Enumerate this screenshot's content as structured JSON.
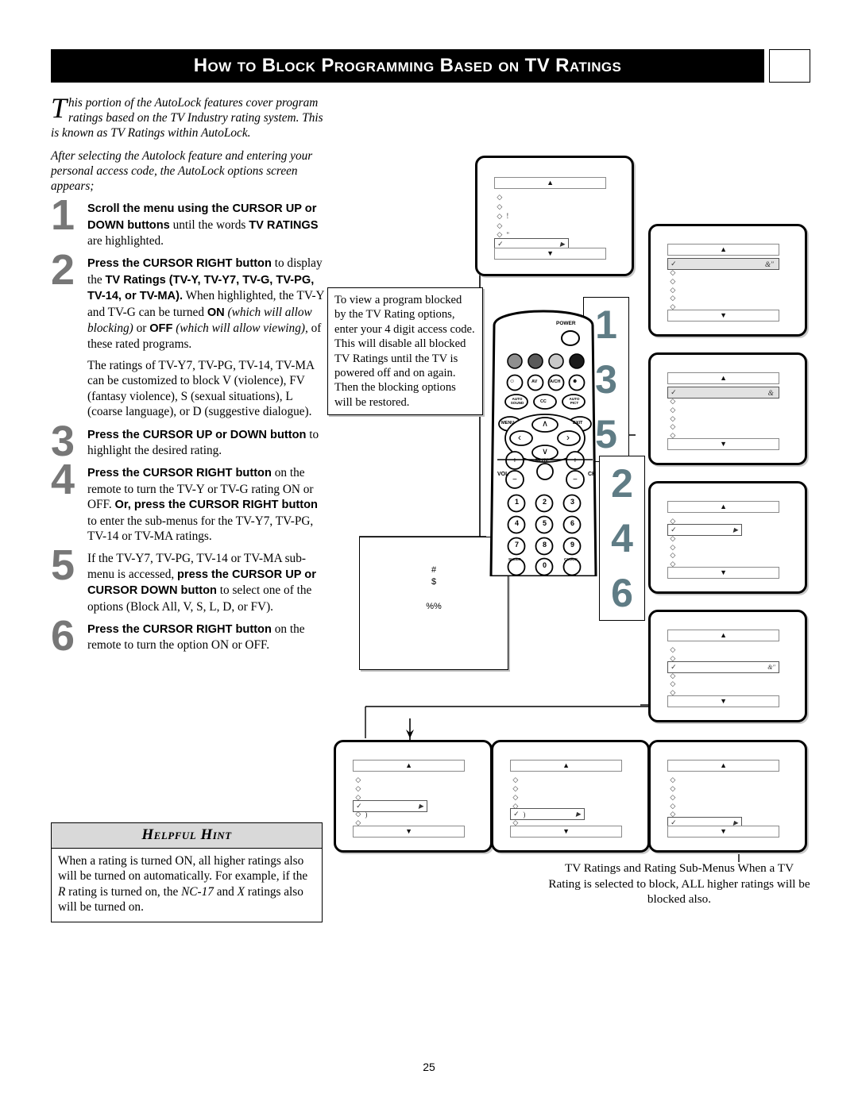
{
  "header": {
    "title": "How to Block Programming Based on TV Ratings",
    "tab": ""
  },
  "intro": {
    "dropcap": "T",
    "paragraph1": "his portion of the AutoLock features cover program ratings based on the TV Industry rating system. This is known as TV Ratings within AutoLock.",
    "paragraph2": "After selecting the Autolock feature and entering your personal access code, the AutoLock options screen appears;"
  },
  "steps": [
    {
      "number": "1",
      "paragraphs": [
        [
          {
            "t": "Scroll the menu using the CURSOR UP or DOWN buttons",
            "s": "b"
          },
          {
            "t": " until the words ",
            "s": "n"
          },
          {
            "t": "TV RATINGS",
            "s": "b"
          },
          {
            "t": " are highlighted.",
            "s": "n"
          }
        ]
      ]
    },
    {
      "number": "2",
      "paragraphs": [
        [
          {
            "t": "Press the CURSOR RIGHT button",
            "s": "b"
          },
          {
            "t": " to display the ",
            "s": "n"
          },
          {
            "t": "TV Ratings (TV-Y, TV-Y7, TV-G, TV-PG, TV-14, or TV-MA).",
            "s": "b"
          },
          {
            "t": " When highlighted, the TV-Y and TV-G can be turned ",
            "s": "n"
          },
          {
            "t": "ON",
            "s": "b"
          },
          {
            "t": " (which will allow blocking)",
            "s": "i"
          },
          {
            "t": " or ",
            "s": "n"
          },
          {
            "t": "OFF",
            "s": "b"
          },
          {
            "t": " (which will allow viewing)",
            "s": "i"
          },
          {
            "t": ", of these rated programs.",
            "s": "n"
          }
        ],
        [
          {
            "t": "The ratings of TV-Y7, TV-PG, TV-14, TV-MA can be customized to block V (violence), FV (fantasy violence), S (sexual situations), L (coarse language), or D (suggestive dialogue).",
            "s": "n"
          }
        ]
      ]
    },
    {
      "number": "3",
      "paragraphs": [
        [
          {
            "t": "Press the CURSOR UP or DOWN button",
            "s": "b"
          },
          {
            "t": " to highlight the desired rating.",
            "s": "n"
          }
        ]
      ]
    },
    {
      "number": "4",
      "paragraphs": [
        [
          {
            "t": "Press the CURSOR RIGHT button",
            "s": "b"
          },
          {
            "t": " on the remote to turn the TV-Y or TV-G rating ON or OFF. ",
            "s": "n"
          },
          {
            "t": "Or, press the CURSOR RIGHT button",
            "s": "b"
          },
          {
            "t": " to enter the sub-menus for the TV-Y7, TV-PG, TV-14 or TV-MA ratings.",
            "s": "n"
          }
        ]
      ]
    },
    {
      "number": "5",
      "paragraphs": [
        [
          {
            "t": "If the TV-Y7, TV-PG, TV-14 or TV-MA sub-menu is accessed, ",
            "s": "n"
          },
          {
            "t": "press the CURSOR UP or CURSOR DOWN button",
            "s": "b"
          },
          {
            "t": " to select one of the options (Block All, V, S, L, D, or FV).",
            "s": "n"
          }
        ]
      ]
    },
    {
      "number": "6",
      "paragraphs": [
        [
          {
            "t": "Press the CURSOR RIGHT button",
            "s": "b"
          },
          {
            "t": " on the remote to turn the option ON or OFF.",
            "s": "n"
          }
        ]
      ]
    }
  ],
  "hint": {
    "title": "Helpful Hint",
    "body_parts": [
      {
        "t": "When a rating is turned ON, all higher ratings also will be turned on automatically. For example, if the ",
        "s": "n"
      },
      {
        "t": "R",
        "s": "i"
      },
      {
        "t": " rating is turned on, the ",
        "s": "n"
      },
      {
        "t": "NC-17",
        "s": "i"
      },
      {
        "t": " and ",
        "s": "n"
      },
      {
        "t": "X",
        "s": "i"
      },
      {
        "t": " ratings also will be turned on.",
        "s": "n"
      }
    ]
  },
  "callouts": {
    "view_program": "To view a program blocked by the TV Rating options, enter your 4 digit access code. This will disable all blocked TV Ratings until the TV is powered off and on again. Then the blocking options will be restored.",
    "symbols_box": [
      "#",
      "$",
      "%%"
    ]
  },
  "badges": {
    "column_a": [
      "1",
      "3",
      "5"
    ],
    "column_b": [
      "2",
      "4",
      "6"
    ]
  },
  "remote": {
    "power_label": "POWER",
    "round_labels": [
      "☺",
      "AV",
      "A/CH",
      "☻"
    ],
    "oval_labels": [
      "AUTO\nSOUND",
      "CC",
      "AUTO\nPICT"
    ],
    "menu_label": "MENU",
    "exit_label": "EXIT",
    "cursor_up": "∧",
    "cursor_down": "∨",
    "cursor_left": "‹",
    "cursor_right": "›",
    "vol_label": "VOL",
    "ch_label": "CH",
    "mute_label": "MUTE",
    "vol_plus": "+",
    "vol_minus": "−",
    "ch_plus": "+",
    "ch_minus": "−",
    "keypad": [
      "1",
      "2",
      "3",
      "4",
      "5",
      "6",
      "7",
      "8",
      "9",
      "0"
    ],
    "sleep_label": "SLEEP",
    "clock_label": "CLOCK",
    "color_buttons": [
      "#8f8f8f",
      "#5a5a5a",
      "#c9c9c9",
      "#1a1a1a"
    ]
  },
  "tv_screens": [
    {
      "id": "tv-autolock-options",
      "top_bar": "▲",
      "bottom_bar": "▼",
      "rows": [
        {
          "marker": "◇",
          "text": "",
          "value": "",
          "state": "plain"
        },
        {
          "marker": "◇",
          "text": "",
          "value": "",
          "state": "plain"
        },
        {
          "marker": "◇",
          "text": "!",
          "value": "",
          "state": "plain"
        },
        {
          "marker": "◇",
          "text": "",
          "value": "",
          "state": "plain"
        },
        {
          "marker": "◇",
          "text": "\"",
          "value": "",
          "state": "plain"
        },
        {
          "marker": "✓",
          "text": "",
          "value": "▶",
          "state": "selected-narrow"
        }
      ]
    },
    {
      "id": "tv-rating-1",
      "top_bar": "▲",
      "bottom_bar": "▼",
      "rows": [
        {
          "marker": "✓",
          "text": "",
          "value": "&\"",
          "state": "highlight"
        },
        {
          "marker": "◇",
          "text": "",
          "value": "",
          "state": "plain"
        },
        {
          "marker": "◇",
          "text": "",
          "value": "",
          "state": "plain"
        },
        {
          "marker": "◇",
          "text": "",
          "value": "",
          "state": "plain"
        },
        {
          "marker": "◇",
          "text": "",
          "value": "",
          "state": "plain"
        },
        {
          "marker": "◇",
          "text": "",
          "value": "",
          "state": "plain"
        }
      ]
    },
    {
      "id": "tv-rating-2",
      "top_bar": "▲",
      "bottom_bar": "▼",
      "rows": [
        {
          "marker": "✓",
          "text": "",
          "value": "&",
          "state": "highlight"
        },
        {
          "marker": "◇",
          "text": "",
          "value": "",
          "state": "plain"
        },
        {
          "marker": "◇",
          "text": "",
          "value": "",
          "state": "plain"
        },
        {
          "marker": "◇",
          "text": "",
          "value": "",
          "state": "plain"
        },
        {
          "marker": "◇",
          "text": "",
          "value": "",
          "state": "plain"
        },
        {
          "marker": "◇",
          "text": "",
          "value": "",
          "state": "plain"
        }
      ]
    },
    {
      "id": "tv-rating-3",
      "top_bar": "▲",
      "bottom_bar": "▼",
      "rows": [
        {
          "marker": "◇",
          "text": "",
          "value": "",
          "state": "plain"
        },
        {
          "marker": "✓",
          "text": "",
          "value": "▶",
          "state": "selected-narrow"
        },
        {
          "marker": "◇",
          "text": "",
          "value": "",
          "state": "plain"
        },
        {
          "marker": "◇",
          "text": "",
          "value": "",
          "state": "plain"
        },
        {
          "marker": "◇",
          "text": "",
          "value": "",
          "state": "plain"
        },
        {
          "marker": "◇",
          "text": "",
          "value": "",
          "state": "plain"
        }
      ]
    },
    {
      "id": "tv-rating-4",
      "top_bar": "▲",
      "bottom_bar": "▼",
      "rows": [
        {
          "marker": "◇",
          "text": "",
          "value": "",
          "state": "plain"
        },
        {
          "marker": "◇",
          "text": "",
          "value": "",
          "state": "plain"
        },
        {
          "marker": "✓",
          "text": "",
          "value": "&\"",
          "state": "selected"
        },
        {
          "marker": "◇",
          "text": "",
          "value": "",
          "state": "plain"
        },
        {
          "marker": "◇",
          "text": "",
          "value": "",
          "state": "plain"
        },
        {
          "marker": "◇",
          "text": "",
          "value": "",
          "state": "plain"
        }
      ]
    },
    {
      "id": "tv-submenu-a",
      "top_bar": "▲",
      "bottom_bar": "▼",
      "rows": [
        {
          "marker": "◇",
          "text": "",
          "value": "",
          "state": "plain"
        },
        {
          "marker": "◇",
          "text": "",
          "value": "",
          "state": "plain"
        },
        {
          "marker": "◇",
          "text": "",
          "value": "",
          "state": "plain"
        },
        {
          "marker": "✓",
          "text": "",
          "value": "▶",
          "state": "selected-narrow"
        },
        {
          "marker": "◇",
          "text": ")",
          "value": "",
          "state": "plain"
        },
        {
          "marker": "◇",
          "text": "",
          "value": "",
          "state": "plain"
        }
      ]
    },
    {
      "id": "tv-submenu-b",
      "top_bar": "▲",
      "bottom_bar": "▼",
      "rows": [
        {
          "marker": "◇",
          "text": "",
          "value": "",
          "state": "plain"
        },
        {
          "marker": "◇",
          "text": "",
          "value": "",
          "state": "plain"
        },
        {
          "marker": "◇",
          "text": "",
          "value": "",
          "state": "plain"
        },
        {
          "marker": "◇",
          "text": "",
          "value": "",
          "state": "plain"
        },
        {
          "marker": "✓",
          "text": ")",
          "value": "▶",
          "state": "selected-narrow"
        },
        {
          "marker": "◇",
          "text": "",
          "value": "",
          "state": "plain"
        }
      ]
    },
    {
      "id": "tv-submenu-c",
      "top_bar": "▲",
      "bottom_bar": "▼",
      "rows": [
        {
          "marker": "◇",
          "text": "",
          "value": "",
          "state": "plain"
        },
        {
          "marker": "◇",
          "text": "",
          "value": "",
          "state": "plain"
        },
        {
          "marker": "◇",
          "text": "",
          "value": "",
          "state": "plain"
        },
        {
          "marker": "◇",
          "text": "",
          "value": "",
          "state": "plain"
        },
        {
          "marker": "◇",
          "text": "",
          "value": "",
          "state": "plain"
        },
        {
          "marker": "✓",
          "text": "",
          "value": "▶",
          "state": "selected-narrow"
        }
      ]
    }
  ],
  "caption": "TV Ratings and Rating Sub-Menus When a TV Rating is selected to block, ALL higher ratings will be blocked also.",
  "page_number": "25"
}
